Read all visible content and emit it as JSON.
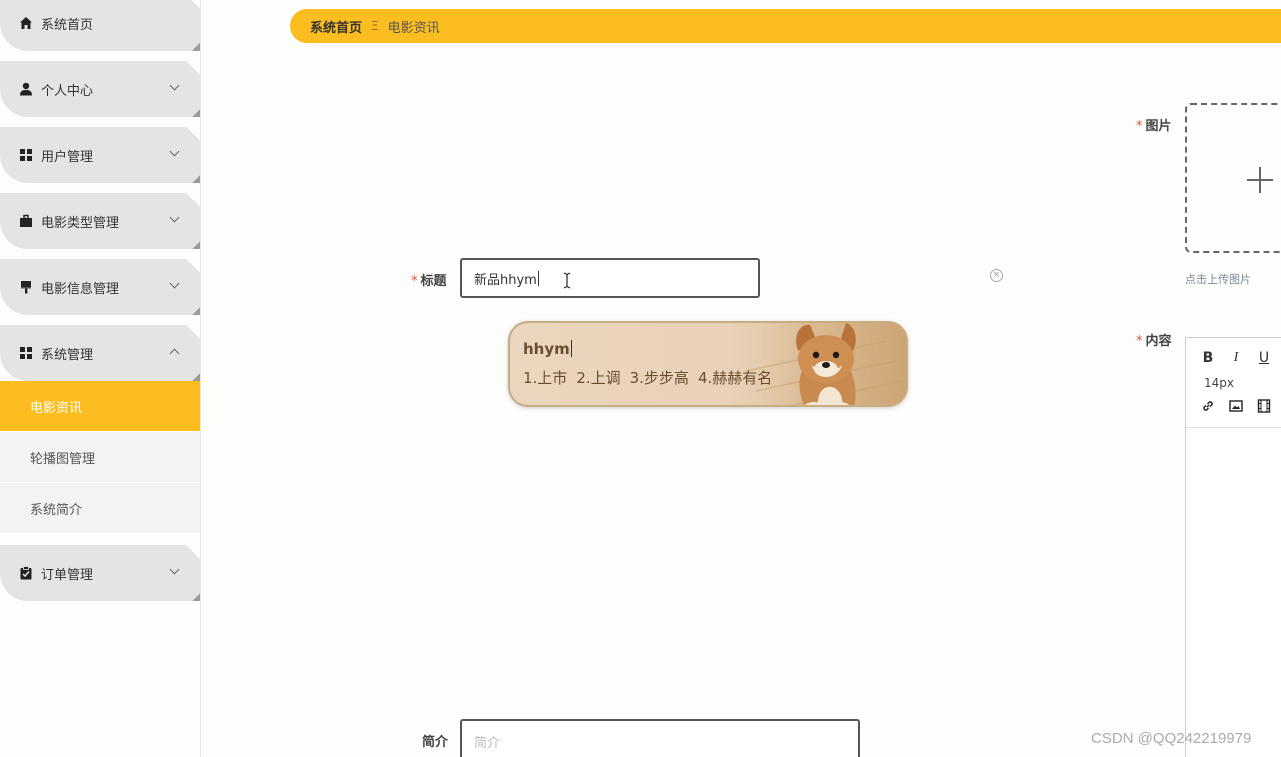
{
  "sidebar": {
    "items": [
      {
        "label": "系统首页",
        "icon": "home-icon"
      },
      {
        "label": "个人中心",
        "icon": "user-icon"
      },
      {
        "label": "用户管理",
        "icon": "grid-icon"
      },
      {
        "label": "电影类型管理",
        "icon": "briefcase-icon"
      },
      {
        "label": "电影信息管理",
        "icon": "brush-icon"
      },
      {
        "label": "系统管理",
        "icon": "grid-icon"
      },
      {
        "label": "订单管理",
        "icon": "clipboard-icon"
      }
    ],
    "submenu": [
      {
        "label": "电影资讯",
        "active": true
      },
      {
        "label": "轮播图管理",
        "active": false
      },
      {
        "label": "系统简介",
        "active": false
      }
    ]
  },
  "breadcrumb": {
    "home": "系统首页",
    "separator": "Ξ",
    "current": "电影资讯"
  },
  "form": {
    "required_mark": "*",
    "title_label": "标题",
    "title_value": "新品hhym",
    "image_label": "图片",
    "upload_hint": "点击上传图片",
    "content_label": "内容",
    "intro_label": "简介",
    "intro_placeholder": "简介"
  },
  "editor": {
    "bold": "B",
    "italic": "I",
    "underline": "U",
    "font_size": "14px"
  },
  "ime": {
    "composition": "hhym",
    "candidates": [
      "1.上市",
      "2.上调",
      "3.步步高",
      "4.赫赫有名"
    ]
  },
  "watermark": "CSDN @QQ242219979",
  "colors": {
    "accent": "#fbbd1f",
    "sidebar_item": "#e6e4e2",
    "required": "#e7503b"
  }
}
